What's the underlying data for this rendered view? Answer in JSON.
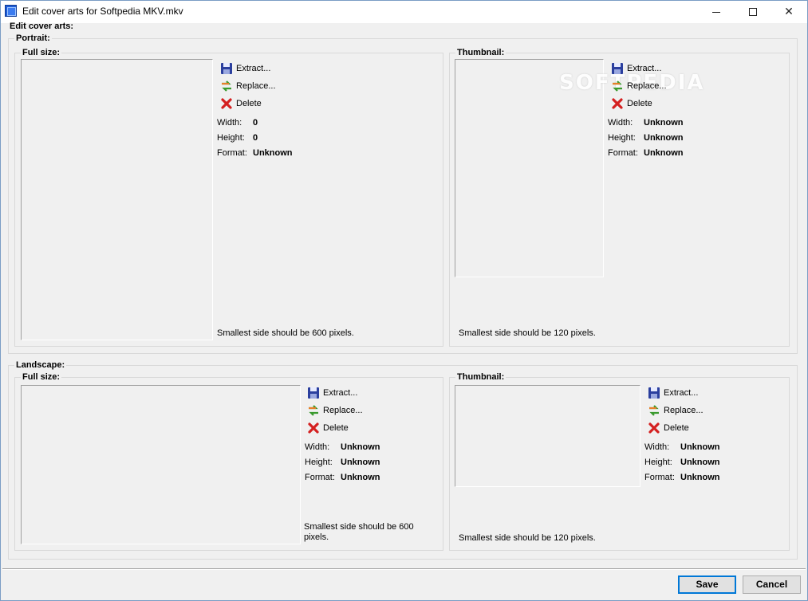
{
  "window": {
    "title": "Edit cover arts for Softpedia MKV.mkv"
  },
  "header": {
    "label": "Edit cover arts:"
  },
  "watermark": "SOFTPEDIA",
  "labels": {
    "extract": "Extract...",
    "replace": "Replace...",
    "delete": "Delete",
    "width": "Width:",
    "height": "Height:",
    "format": "Format:"
  },
  "portrait": {
    "title": "Portrait:",
    "full": {
      "title": "Full size:",
      "width": "0",
      "height": "0",
      "format": "Unknown",
      "note": "Smallest side should be 600 pixels."
    },
    "thumb": {
      "title": "Thumbnail:",
      "width": "Unknown",
      "height": "Unknown",
      "format": "Unknown",
      "note": "Smallest side should be 120 pixels."
    }
  },
  "landscape": {
    "title": "Landscape:",
    "full": {
      "title": "Full size:",
      "width": "Unknown",
      "height": "Unknown",
      "format": "Unknown",
      "note": "Smallest side should be 600 pixels."
    },
    "thumb": {
      "title": "Thumbnail:",
      "width": "Unknown",
      "height": "Unknown",
      "format": "Unknown",
      "note": "Smallest side should be 120 pixels."
    }
  },
  "buttons": {
    "save": "Save",
    "cancel": "Cancel"
  },
  "colors": {
    "accent": "#0078d7",
    "delete_red": "#d42020",
    "save_blue": "#2b3f9e",
    "replace_green": "#3a9a2e",
    "replace_orange": "#e8802a"
  }
}
